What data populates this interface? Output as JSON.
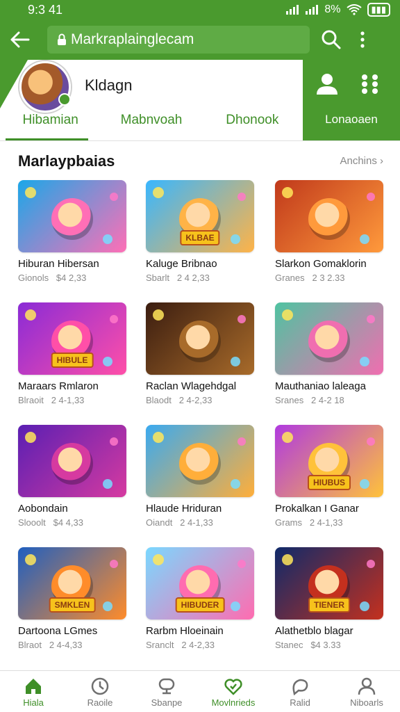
{
  "status": {
    "time": "9:3 41",
    "battery": "8%"
  },
  "appbar": {
    "url": "Markraplainglecam"
  },
  "profile": {
    "name": "Kldagn"
  },
  "tabs": [
    {
      "label": "Hibamian",
      "active": true
    },
    {
      "label": "Mabnvoah",
      "active": false
    },
    {
      "label": "Dhonook",
      "active": false
    }
  ],
  "header_right": {
    "login_label": "Lonaoaen"
  },
  "section": {
    "title": "Marlaypbaias",
    "more": "Anchins ›"
  },
  "games": [
    {
      "title": "Hiburan Hibersan",
      "category": "Gionols",
      "meta": "$4 2,33",
      "badge": "",
      "colors": [
        "#1ba7e8",
        "#ff6fb6"
      ]
    },
    {
      "title": "Kaluge Bribnao",
      "category": "Sbarlt",
      "meta": "2 4 2,33",
      "badge": "KLBAE",
      "colors": [
        "#38b6ff",
        "#ffb347"
      ]
    },
    {
      "title": "Slarkon Gomaklorin",
      "category": "Granes",
      "meta": "2 3 2.33",
      "badge": "",
      "colors": [
        "#c0391b",
        "#ff9a3c"
      ]
    },
    {
      "title": "Maraars Rmlaron",
      "category": "Blraoit",
      "meta": "2 4-1,33",
      "badge": "HIBULE",
      "colors": [
        "#8a2bd6",
        "#ff4fa8"
      ]
    },
    {
      "title": "Raclan Wlagehdgal",
      "category": "Blaodt",
      "meta": "2 4-2,33",
      "badge": "",
      "colors": [
        "#3b1d10",
        "#a86b2a"
      ]
    },
    {
      "title": "Mauthaniao laleaga",
      "category": "Sranes",
      "meta": "2 4-2 18",
      "badge": "",
      "colors": [
        "#4fc3a1",
        "#f06eb0"
      ]
    },
    {
      "title": "Aobondain",
      "category": "Slooolt",
      "meta": "$4 4,33",
      "badge": "",
      "colors": [
        "#5a1fb3",
        "#d63aa0"
      ]
    },
    {
      "title": "Hlaude Hriduran",
      "category": "Oiandt",
      "meta": "2 4-1,33",
      "badge": "",
      "colors": [
        "#3aaaf0",
        "#ffae3a"
      ]
    },
    {
      "title": "Prokalkan I Ganar",
      "category": "Grams",
      "meta": "2 4-1,33",
      "badge": "HIUBUS",
      "colors": [
        "#b03ae0",
        "#ffc23a"
      ]
    },
    {
      "title": "Dartoona LGmes",
      "category": "Blraot",
      "meta": "2 4-4,33",
      "badge": "SMKLEN",
      "colors": [
        "#1f5fc0",
        "#ff8c2a"
      ]
    },
    {
      "title": "Rarbm Hloeinain",
      "category": "Sranclt",
      "meta": "2 4-2,33",
      "badge": "HIBUDER",
      "colors": [
        "#7ad8ff",
        "#ff6cb0"
      ]
    },
    {
      "title": "Alathetblo blagar",
      "category": "Stanec",
      "meta": "$4 3.33",
      "badge": "TIENER",
      "colors": [
        "#0f2a6a",
        "#c4301e"
      ]
    }
  ],
  "bottomnav": [
    {
      "label": "Hiala",
      "icon": "home-icon",
      "active": true
    },
    {
      "label": "Raoile",
      "icon": "clock-icon",
      "active": false
    },
    {
      "label": "Sbanpe",
      "icon": "store-icon",
      "active": false
    },
    {
      "label": "Movlnrieds",
      "icon": "heart-icon",
      "active": true
    },
    {
      "label": "Ralid",
      "icon": "chat-icon",
      "active": false
    },
    {
      "label": "Niboarls",
      "icon": "profile-icon",
      "active": false
    }
  ],
  "colors": {
    "brand": "#4a9a2e",
    "accent": "#3f8f28"
  }
}
